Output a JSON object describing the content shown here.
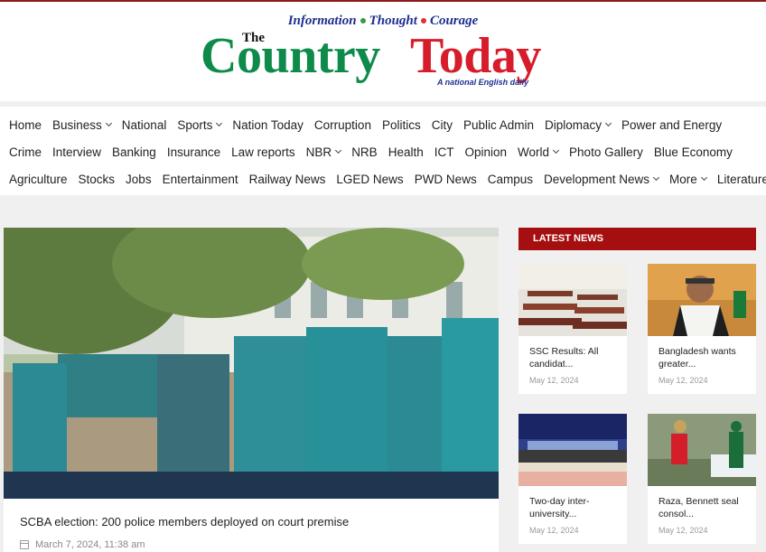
{
  "header": {
    "tagline": [
      "Information",
      "Thought",
      "Courage"
    ],
    "tagline_dot_colors": [
      "#2f9e44",
      "#e03131"
    ],
    "logo_the": "The",
    "logo_country": "Country",
    "logo_today": "Today",
    "logo_subtitle": "A national English daily"
  },
  "colors": {
    "brand_green": "#0e8a4a",
    "brand_red": "#d71c2b",
    "accent_bar": "#a50f0f",
    "navy": "#1d2f8f"
  },
  "nav": {
    "row1": [
      {
        "label": "Home",
        "dropdown": false
      },
      {
        "label": "Business",
        "dropdown": true
      },
      {
        "label": "National",
        "dropdown": false
      },
      {
        "label": "Sports",
        "dropdown": true
      },
      {
        "label": "Nation Today",
        "dropdown": false
      },
      {
        "label": "Corruption",
        "dropdown": false
      },
      {
        "label": "Politics",
        "dropdown": false
      },
      {
        "label": "City",
        "dropdown": false
      },
      {
        "label": "Public Admin",
        "dropdown": false
      },
      {
        "label": "Diplomacy",
        "dropdown": true
      },
      {
        "label": "Power and Energy",
        "dropdown": false
      }
    ],
    "row2": [
      {
        "label": "Crime",
        "dropdown": false
      },
      {
        "label": "Interview",
        "dropdown": false
      },
      {
        "label": "Banking",
        "dropdown": false
      },
      {
        "label": "Insurance",
        "dropdown": false
      },
      {
        "label": "Law reports",
        "dropdown": false
      },
      {
        "label": "NBR",
        "dropdown": true
      },
      {
        "label": "NRB",
        "dropdown": false
      },
      {
        "label": "Health",
        "dropdown": false
      },
      {
        "label": "ICT",
        "dropdown": false
      },
      {
        "label": "Opinion",
        "dropdown": false
      },
      {
        "label": "World",
        "dropdown": true
      },
      {
        "label": "Photo Gallery",
        "dropdown": false
      },
      {
        "label": "Blue Economy",
        "dropdown": false
      }
    ],
    "row3": [
      {
        "label": "Agriculture",
        "dropdown": false
      },
      {
        "label": "Stocks",
        "dropdown": false
      },
      {
        "label": "Jobs",
        "dropdown": false
      },
      {
        "label": "Entertainment",
        "dropdown": false
      },
      {
        "label": "Railway News",
        "dropdown": false
      },
      {
        "label": "LGED News",
        "dropdown": false
      },
      {
        "label": "PWD News",
        "dropdown": false
      },
      {
        "label": "Campus",
        "dropdown": false
      },
      {
        "label": "Development News",
        "dropdown": true
      },
      {
        "label": "More",
        "dropdown": true
      },
      {
        "label": "Literature",
        "dropdown": false
      }
    ]
  },
  "main_story": {
    "headline": "SCBA election: 200 police members deployed on court premise",
    "date": "March 7, 2024, 11:38 am"
  },
  "latest": {
    "heading": "LATEST NEWS",
    "items": [
      {
        "title": "SSC Results: All candidat...",
        "date": "May 12, 2024"
      },
      {
        "title": "Bangladesh wants greater...",
        "date": "May 12, 2024"
      },
      {
        "title": "Two-day inter-university...",
        "date": "May 12, 2024"
      },
      {
        "title": "Raza, Bennett seal consol...",
        "date": "May 12, 2024"
      }
    ]
  }
}
